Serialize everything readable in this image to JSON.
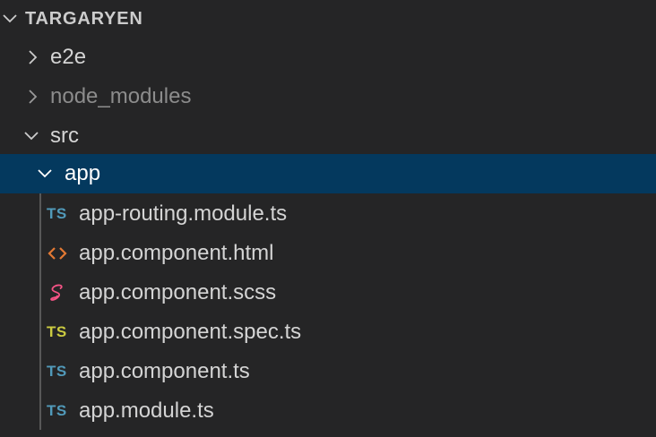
{
  "explorer": {
    "root": {
      "label": "TARGARYEN",
      "expanded": true
    },
    "tree": [
      {
        "label": "e2e",
        "kind": "folder",
        "expanded": false
      },
      {
        "label": "node_modules",
        "kind": "folder",
        "expanded": false,
        "dimmed": true
      },
      {
        "label": "src",
        "kind": "folder",
        "expanded": true
      },
      {
        "label": "app",
        "kind": "folder",
        "expanded": true,
        "selected": true
      },
      {
        "label": "app-routing.module.ts",
        "kind": "file",
        "icon": "typescript-icon",
        "icon_text": "TS",
        "icon_color": "#519aba"
      },
      {
        "label": "app.component.html",
        "kind": "file",
        "icon": "html-code-icon",
        "icon_color": "#e37933"
      },
      {
        "label": "app.component.scss",
        "kind": "file",
        "icon": "sass-icon",
        "icon_color": "#f55385"
      },
      {
        "label": "app.component.spec.ts",
        "kind": "file",
        "icon": "typescript-spec-icon",
        "icon_text": "TS",
        "icon_color": "#cbcb41"
      },
      {
        "label": "app.component.ts",
        "kind": "file",
        "icon": "typescript-icon",
        "icon_text": "TS",
        "icon_color": "#519aba"
      },
      {
        "label": "app.module.ts",
        "kind": "file",
        "icon": "typescript-icon",
        "icon_text": "TS",
        "icon_color": "#519aba"
      }
    ]
  },
  "colors": {
    "background": "#252526",
    "selection": "#04395e",
    "indent_guide": "#585858"
  }
}
